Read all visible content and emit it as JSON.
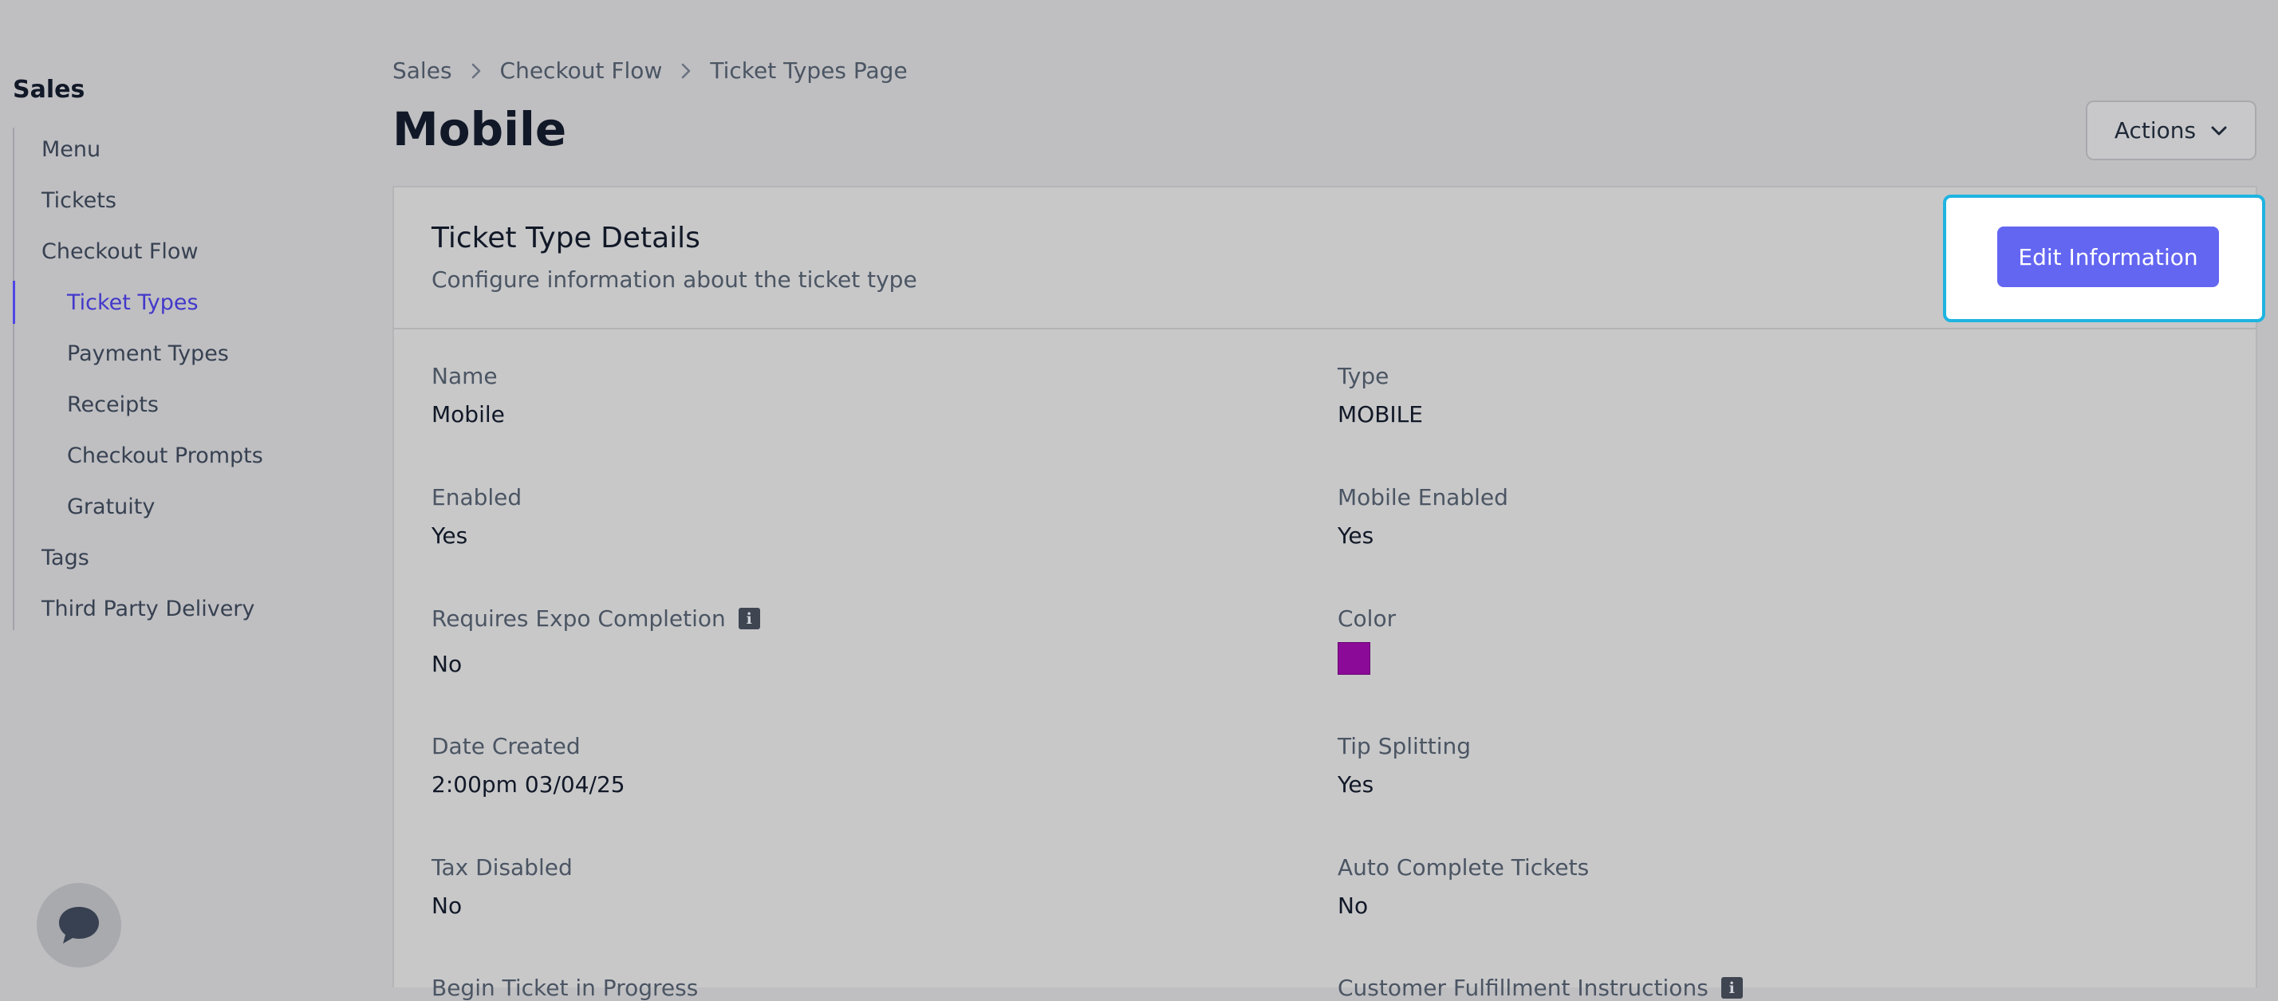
{
  "sidebar": {
    "title": "Sales",
    "items": [
      {
        "label": "Menu"
      },
      {
        "label": "Tickets"
      },
      {
        "label": "Checkout Flow"
      },
      {
        "label": "Ticket Types"
      },
      {
        "label": "Payment Types"
      },
      {
        "label": "Receipts"
      },
      {
        "label": "Checkout Prompts"
      },
      {
        "label": "Gratuity"
      },
      {
        "label": "Tags"
      },
      {
        "label": "Third Party Delivery"
      }
    ],
    "active_item": "Ticket Types"
  },
  "breadcrumb": [
    "Sales",
    "Checkout Flow",
    "Ticket Types Page"
  ],
  "page": {
    "title": "Mobile",
    "actions_label": "Actions"
  },
  "card": {
    "title": "Ticket Type Details",
    "subtitle": "Configure information about the ticket type",
    "edit_label": "Edit Information"
  },
  "fields": {
    "name": {
      "label": "Name",
      "value": "Mobile"
    },
    "type": {
      "label": "Type",
      "value": "MOBILE"
    },
    "enabled": {
      "label": "Enabled",
      "value": "Yes"
    },
    "mobile_enabled": {
      "label": "Mobile Enabled",
      "value": "Yes"
    },
    "requires_expo": {
      "label": "Requires Expo Completion",
      "value": "No"
    },
    "color": {
      "label": "Color",
      "value": "#8b0a98"
    },
    "date_created": {
      "label": "Date Created",
      "value": "2:00pm 03/04/25"
    },
    "tip_splitting": {
      "label": "Tip Splitting",
      "value": "Yes"
    },
    "tax_disabled": {
      "label": "Tax Disabled",
      "value": "No"
    },
    "auto_complete": {
      "label": "Auto Complete Tickets",
      "value": "No"
    },
    "begin_in_progress": {
      "label": "Begin Ticket in Progress"
    },
    "customer_fulfillment": {
      "label": "Customer Fulfillment Instructions"
    }
  },
  "colors": {
    "accent": "#6366f1",
    "active_text": "#4338ca",
    "highlight": "#1eb4e0"
  }
}
